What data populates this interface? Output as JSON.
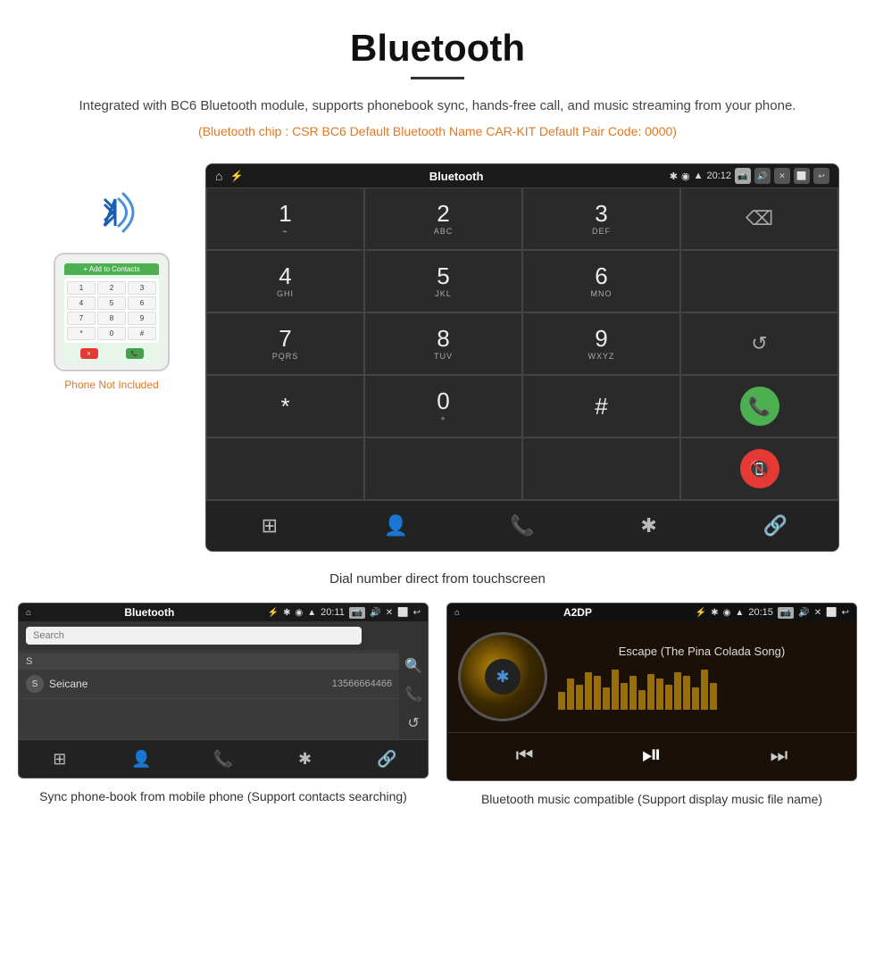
{
  "page": {
    "title": "Bluetooth",
    "title_underline": true,
    "description": "Integrated with BC6 Bluetooth module, supports phonebook sync, hands-free call, and music streaming from your phone.",
    "specs": "(Bluetooth chip : CSR BC6    Default Bluetooth Name CAR-KIT    Default Pair Code: 0000)",
    "dial_caption": "Dial number direct from touchscreen"
  },
  "android_dial": {
    "statusbar": {
      "home": "⌂",
      "title": "Bluetooth",
      "usb": "⚡",
      "bt_icon": "✱",
      "location": "◉",
      "signal": "▲",
      "time": "20:12",
      "camera": "📷",
      "volume": "🔊",
      "close": "✕",
      "window": "⬜",
      "back": "↩"
    },
    "keys": [
      {
        "main": "1",
        "sub": "⌁",
        "col": 0
      },
      {
        "main": "2",
        "sub": "ABC",
        "col": 1
      },
      {
        "main": "3",
        "sub": "DEF",
        "col": 2
      },
      {
        "main": "⌫",
        "sub": "",
        "col": 3,
        "type": "backspace"
      },
      {
        "main": "4",
        "sub": "GHI",
        "col": 0
      },
      {
        "main": "5",
        "sub": "JKL",
        "col": 1
      },
      {
        "main": "6",
        "sub": "MNO",
        "col": 2
      },
      {
        "main": "",
        "sub": "",
        "col": 3,
        "type": "empty"
      },
      {
        "main": "7",
        "sub": "PQRS",
        "col": 0
      },
      {
        "main": "8",
        "sub": "TUV",
        "col": 1
      },
      {
        "main": "9",
        "sub": "WXYZ",
        "col": 2
      },
      {
        "main": "↺",
        "sub": "",
        "col": 3,
        "type": "refresh"
      },
      {
        "main": "*",
        "sub": "",
        "col": 0
      },
      {
        "main": "0",
        "sub": "+",
        "col": 1
      },
      {
        "main": "#",
        "sub": "",
        "col": 2
      },
      {
        "main": "call",
        "sub": "",
        "col": 3,
        "type": "call-green"
      },
      {
        "main": "end",
        "sub": "",
        "col": 4,
        "type": "call-red"
      }
    ],
    "bottom_nav": [
      "⊞",
      "👤",
      "📞",
      "✱",
      "🔗"
    ]
  },
  "phonebook": {
    "title": "Bluetooth",
    "usb": "⚡",
    "time": "20:11",
    "search_placeholder": "Search",
    "section_header": "S",
    "contact_name": "Seicane",
    "contact_number": "13566664466",
    "right_icons": [
      "🔍",
      "📞",
      "↺"
    ],
    "bottom_nav": [
      "⊞",
      "👤",
      "📞",
      "✱",
      "🔗"
    ],
    "caption": "Sync phone-book from mobile phone\n(Support contacts searching)"
  },
  "music": {
    "title": "A2DP",
    "usb": "⚡",
    "time": "20:15",
    "song_title": "Escape (The Pina Colada Song)",
    "spectrum_bars": [
      20,
      35,
      28,
      42,
      38,
      25,
      45,
      30,
      38,
      22,
      40,
      35,
      28,
      42,
      38,
      25,
      45,
      30
    ],
    "controls": [
      "⏮",
      "⏯",
      "⏭"
    ],
    "caption": "Bluetooth music compatible\n(Support display music file name)"
  },
  "phone_graphic": {
    "not_included": "Phone Not Included",
    "screen_header": "+ Add to Contacts",
    "keys": [
      "1",
      "2",
      "3",
      "4",
      "5",
      "6",
      "7",
      "8",
      "9",
      "*",
      "0",
      "#"
    ]
  }
}
